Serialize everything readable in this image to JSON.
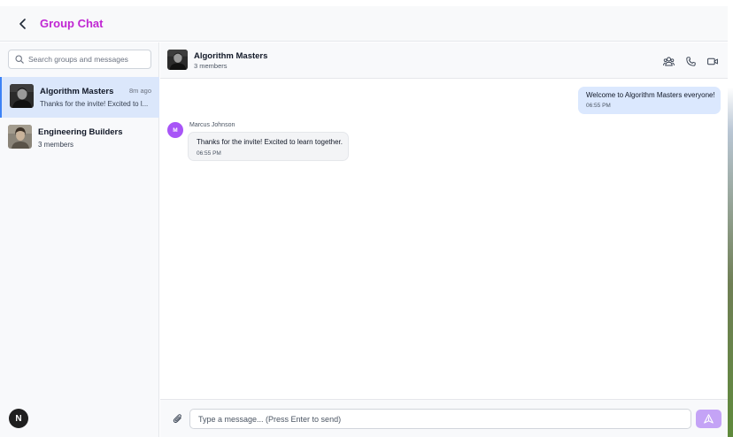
{
  "app": {
    "title": "Group Chat",
    "accent": "#c026d3"
  },
  "search": {
    "placeholder": "Search groups and messages"
  },
  "groups": [
    {
      "name": "Algorithm Masters",
      "time": "8m ago",
      "preview": "Thanks for the invite! Excited to l...",
      "active": true
    },
    {
      "name": "Engineering Builders",
      "members": "3 members",
      "active": false
    }
  ],
  "chat": {
    "name": "Algorithm Masters",
    "members": "3 members",
    "icons": [
      "group-icon",
      "phone-icon",
      "video-icon"
    ]
  },
  "messages": [
    {
      "direction": "outgoing",
      "text": "Welcome to Algorithm Masters everyone!",
      "time": "06:55 PM"
    },
    {
      "direction": "incoming",
      "sender": "Marcus Johnson",
      "initial": "M",
      "text": "Thanks for the invite! Excited to learn together.",
      "time": "06:55 PM"
    }
  ],
  "composer": {
    "placeholder": "Type a message... (Press Enter to send)"
  },
  "badge": {
    "letter": "N"
  },
  "colors": {
    "outgoing_bubble": "#dbe8fe",
    "active_group": "#dbe7fb",
    "send_button": "#c4a3f6",
    "avatar_purple": "#a855f7"
  }
}
